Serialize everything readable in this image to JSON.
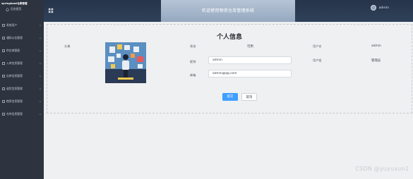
{
  "sidebar": {
    "brand": "springboot仓库管理",
    "home_label": "后台首页",
    "items": [
      {
        "label": "系统用户",
        "icon": "user-icon"
      },
      {
        "label": "通知公告管理",
        "icon": "bell-icon"
      },
      {
        "label": "供应商管理",
        "icon": "truck-icon"
      },
      {
        "label": "入库信息管理",
        "icon": "box-in-icon"
      },
      {
        "label": "出库信息管理",
        "icon": "box-out-icon"
      },
      {
        "label": "退货信息管理",
        "icon": "return-icon"
      },
      {
        "label": "物资信息管理",
        "icon": "goods-icon"
      },
      {
        "label": "仓库信息管理",
        "icon": "warehouse-icon"
      }
    ]
  },
  "header": {
    "title": "欢迎使用物资仓库管理系统",
    "username": "admin"
  },
  "profile": {
    "title": "个人信息",
    "avatar_label": "头像",
    "status_label": "状态",
    "status_value": "可用",
    "username_label": "用户名",
    "username_value": "admin",
    "nickname_label": "昵称",
    "nickname_value": "admin",
    "role_label": "用户组",
    "role_value": "管理员",
    "email_label": "邮箱",
    "email_value": "admin@qq.com",
    "submit_label": "提交",
    "cancel_label": "取消"
  },
  "watermark": "CSDN @yuyuxun1",
  "colors": {
    "sidebar_bg": "#2d3440",
    "header_bg": "#2f4159",
    "primary": "#409eff",
    "card_bg": "#eef0f1"
  }
}
